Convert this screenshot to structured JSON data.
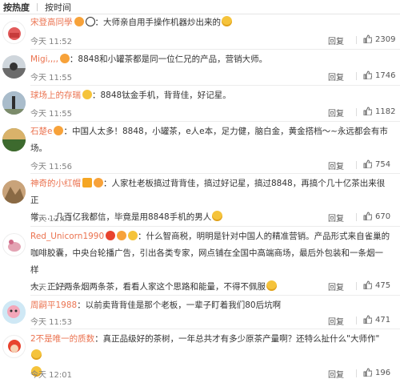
{
  "tabs": [
    {
      "label": "按热度",
      "active": true
    },
    {
      "label": "按时间",
      "active": false
    }
  ],
  "reply_label": "回复",
  "comments": [
    {
      "user": "宋登高同學",
      "segments": [
        "：大师亲自用手操作机器炒出来的"
      ],
      "time": "今天 11:52",
      "likes": "2309"
    },
    {
      "user": "Migi,,,,",
      "segments": [
        "：8848和小罐茶都是同一位仁兄的产品，营销大师。"
      ],
      "time": "今天 11:55",
      "likes": "1746"
    },
    {
      "user": "球场上的存瑞",
      "segments": [
        "：8848钛金手机，背背佳，好记星。"
      ],
      "time": "今天 11:55",
      "likes": "1182"
    },
    {
      "user": "石楚e",
      "segments": [
        "：中国人太多！8848，小罐茶，e人e本，足力健，脑白金，黄金搭档～~永远都会有市",
        "场。"
      ],
      "time": "今天 11:56",
      "likes": "754"
    },
    {
      "user": "神奇的小红帽",
      "segments": [
        "：人家杜老板搞过背背佳，搞过好记星，搞过8848，再搞个几十亿茶出来很正",
        "常……几百亿我都信，毕竟是用8848手机的男人"
      ],
      "time": "今天 12:01",
      "likes": "670"
    },
    {
      "user": "Red_Unicorn1990",
      "segments": [
        "：什么智商税，明明是针对中国人的精准营销。产品形式来自雀巢的",
        "咖啡胶囊，中央台轮播广告，引出各类专家，网点铺在全国中高端商场，最后外包装和一条烟一样",
        "大，正好两条烟两条茶，看看人家这个思路和能量，不得不佩服"
      ],
      "time": "今天 11:53",
      "likes": "475"
    },
    {
      "user": "周嗣平1988",
      "segments": [
        "：以前卖背背佳是那个老板，一辈子盯着我们80后坑啊"
      ],
      "time": "今天 11:53",
      "likes": "471"
    },
    {
      "user": "2不是唯一的质数",
      "segments": [
        "：真正品级好的茶树，一年总共才有多少原茶产量啊？还特么扯什么\"大师作\"",
        ""
      ],
      "time": "今天 12:01",
      "likes": "196"
    }
  ]
}
